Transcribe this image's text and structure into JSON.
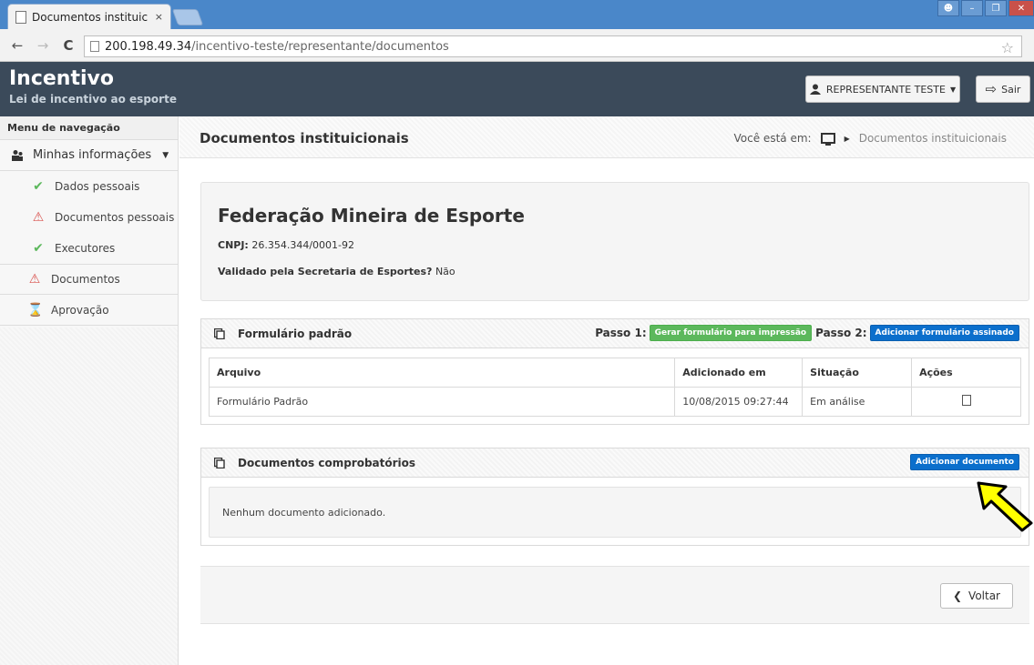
{
  "browser": {
    "tab_title": "Documentos instituic",
    "tab_close": "×",
    "url_host": "200.198.49.34",
    "url_path": "/incentivo-teste/representante/documentos"
  },
  "header": {
    "brand_title": "Incentivo",
    "brand_subtitle": "Lei de incentivo ao esporte",
    "user_label": "REPRESENTANTE TESTE",
    "logout_label": "Sair"
  },
  "sidebar": {
    "heading": "Menu de navegação",
    "group_label": "Minhas informações",
    "items": [
      {
        "label": "Dados pessoais",
        "icon": "check-icon",
        "status": "ok"
      },
      {
        "label": "Documentos pessoais",
        "icon": "warning-icon",
        "status": "warn"
      },
      {
        "label": "Executores",
        "icon": "check-icon",
        "status": "ok"
      },
      {
        "label": "Documentos",
        "icon": "warning-icon",
        "status": "warn"
      },
      {
        "label": "Aprovação",
        "icon": "hourglass-icon",
        "status": "pending"
      }
    ]
  },
  "page": {
    "title": "Documentos instituicionais",
    "breadcrumb_prefix": "Você está em:",
    "breadcrumb_current": "Documentos instituicionais"
  },
  "org": {
    "name": "Federação Mineira de Esporte",
    "cnpj_label": "CNPJ:",
    "cnpj_value": "26.354.344/0001-92",
    "validated_label": "Validado pela Secretaria de Esportes?",
    "validated_value": "Não"
  },
  "form_panel": {
    "title": "Formulário padrão",
    "step1_label": "Passo 1:",
    "step1_button": "Gerar formulário para impressão",
    "step2_label": "Passo 2:",
    "step2_button": "Adicionar formulário assinado",
    "columns": [
      "Arquivo",
      "Adicionado em",
      "Situação",
      "Ações"
    ],
    "rows": [
      {
        "file": "Formulário Padrão",
        "added": "10/08/2015 09:27:44",
        "status": "Em análise"
      }
    ]
  },
  "docs_panel": {
    "title": "Documentos comprobatórios",
    "add_button": "Adicionar documento",
    "empty_text": "Nenhum documento adicionado."
  },
  "footer": {
    "back_button": "Voltar"
  },
  "colors": {
    "header_bg": "#3b4a5a",
    "green": "#5cb85c",
    "blue": "#0b6fcc",
    "warn": "#d9534f",
    "highlight_arrow": "#ffff00"
  }
}
